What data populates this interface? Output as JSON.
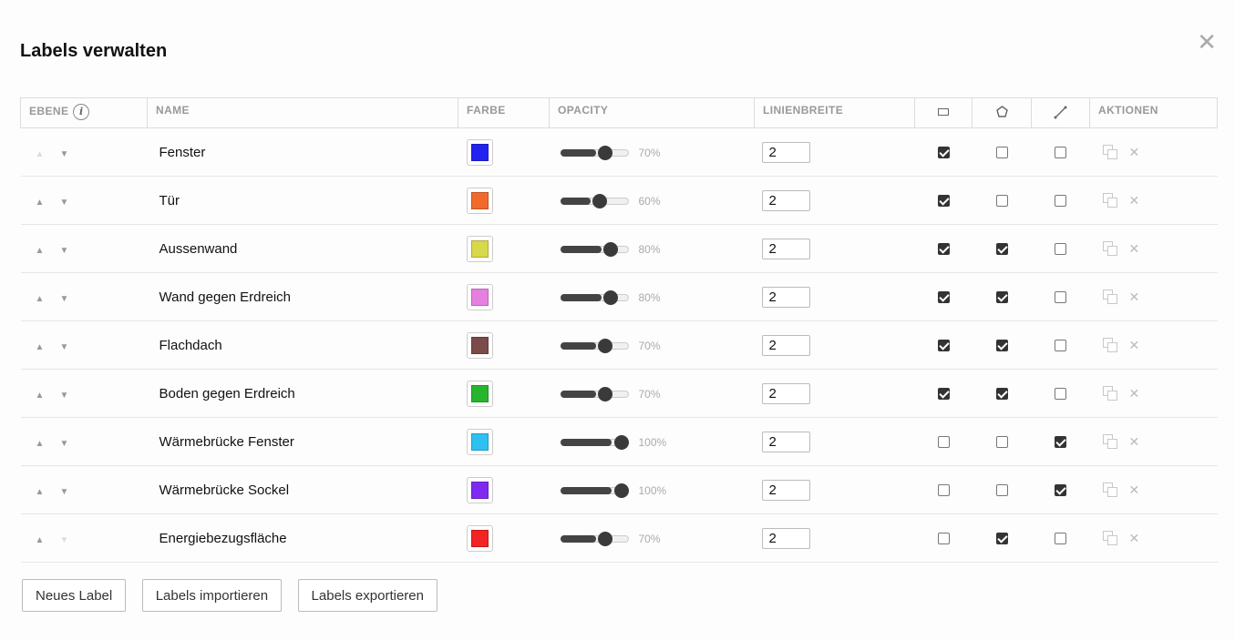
{
  "dialog": {
    "title": "Labels verwalten",
    "close_symbol": "✕"
  },
  "table": {
    "headers": {
      "ebene": "EBENE",
      "info_symbol": "i",
      "name": "NAME",
      "farbe": "FARBE",
      "opacity": "OPACITY",
      "linienbreite": "LINIENBREITE",
      "rect_icon": "rectangle-tool-icon",
      "polygon_icon": "polygon-tool-icon",
      "line_icon": "line-tool-icon",
      "aktionen": "AKTIONEN"
    },
    "up_symbol": "▲",
    "down_symbol": "▼",
    "delete_symbol": "✕",
    "rows": [
      {
        "name": "Fenster",
        "color": "#2323f0",
        "opacity": 70,
        "opacity_label": "70%",
        "linewidth": "2",
        "rect": true,
        "polygon": false,
        "line": false,
        "up_enabled": false,
        "down_enabled": true
      },
      {
        "name": "Tür",
        "color": "#f26a2b",
        "opacity": 60,
        "opacity_label": "60%",
        "linewidth": "2",
        "rect": true,
        "polygon": false,
        "line": false,
        "up_enabled": true,
        "down_enabled": true
      },
      {
        "name": "Aussenwand",
        "color": "#d9d74a",
        "opacity": 80,
        "opacity_label": "80%",
        "linewidth": "2",
        "rect": true,
        "polygon": true,
        "line": false,
        "up_enabled": true,
        "down_enabled": true
      },
      {
        "name": "Wand gegen Erdreich",
        "color": "#e680e0",
        "opacity": 80,
        "opacity_label": "80%",
        "linewidth": "2",
        "rect": true,
        "polygon": true,
        "line": false,
        "up_enabled": true,
        "down_enabled": true
      },
      {
        "name": "Flachdach",
        "color": "#7a4b48",
        "opacity": 70,
        "opacity_label": "70%",
        "linewidth": "2",
        "rect": true,
        "polygon": true,
        "line": false,
        "up_enabled": true,
        "down_enabled": true
      },
      {
        "name": "Boden gegen Erdreich",
        "color": "#28b52e",
        "opacity": 70,
        "opacity_label": "70%",
        "linewidth": "2",
        "rect": true,
        "polygon": true,
        "line": false,
        "up_enabled": true,
        "down_enabled": true
      },
      {
        "name": "Wärmebrücke Fenster",
        "color": "#2fc0f2",
        "opacity": 100,
        "opacity_label": "100%",
        "linewidth": "2",
        "rect": false,
        "polygon": false,
        "line": true,
        "up_enabled": true,
        "down_enabled": true
      },
      {
        "name": "Wärmebrücke Sockel",
        "color": "#7f2af0",
        "opacity": 100,
        "opacity_label": "100%",
        "linewidth": "2",
        "rect": false,
        "polygon": false,
        "line": true,
        "up_enabled": true,
        "down_enabled": true
      },
      {
        "name": "Energiebezugsfläche",
        "color": "#f22424",
        "opacity": 70,
        "opacity_label": "70%",
        "linewidth": "2",
        "rect": false,
        "polygon": true,
        "line": false,
        "up_enabled": true,
        "down_enabled": false
      }
    ]
  },
  "footer": {
    "new_label": "Neues Label",
    "import_label": "Labels importieren",
    "export_label": "Labels exportieren"
  }
}
